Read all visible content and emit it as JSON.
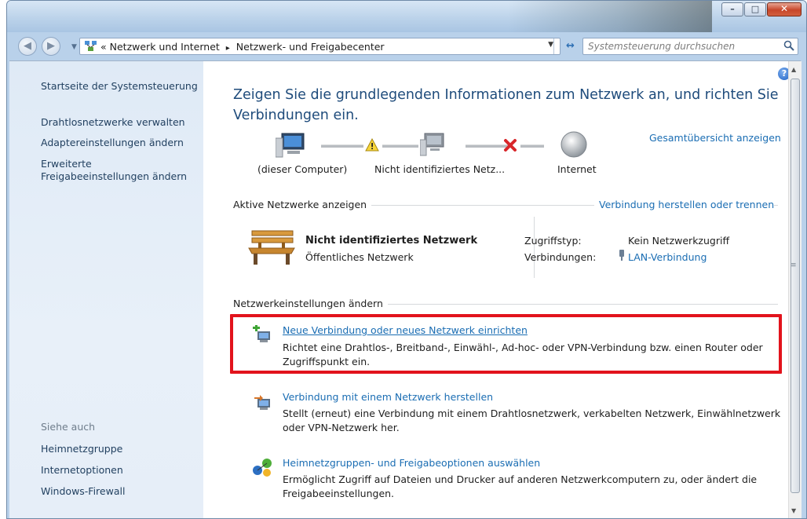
{
  "titlebar": {
    "controls": {
      "minimize": "–",
      "maximize": "□",
      "close": "✕"
    }
  },
  "address": {
    "overflow": "«",
    "path": [
      "Netzwerk und Internet",
      "Netzwerk- und Freigabecenter"
    ],
    "separator": "▸"
  },
  "search": {
    "placeholder": "Systemsteuerung durchsuchen"
  },
  "sidebar": {
    "items": [
      {
        "label": "Startseite der Systemsteuerung"
      },
      {
        "label": "Drahtlosnetzwerke verwalten"
      },
      {
        "label": "Adaptereinstellungen ändern"
      },
      {
        "label": "Erweiterte Freigabeeinstellungen ändern"
      }
    ],
    "see_also_title": "Siehe auch",
    "see_also": [
      {
        "label": "Heimnetzgruppe"
      },
      {
        "label": "Internetoptionen"
      },
      {
        "label": "Windows-Firewall"
      }
    ]
  },
  "main": {
    "heading": "Zeigen Sie die grundlegenden Informationen zum Netzwerk an, und richten Sie Verbindungen ein.",
    "overview_link": "Gesamtübersicht anzeigen",
    "map": {
      "computer": "(dieser Computer)",
      "network": "Nicht identifiziertes Netz...",
      "internet": "Internet"
    },
    "active": {
      "title": "Aktive Netzwerke anzeigen",
      "connect_link": "Verbindung herstellen oder trennen",
      "network_name": "Nicht identifiziertes Netzwerk",
      "network_type": "Öffentliches Netzwerk",
      "access_label": "Zugriffstyp:",
      "access_value": "Kein Netzwerkzugriff",
      "connections_label": "Verbindungen:",
      "connections_value": "LAN-Verbindung"
    },
    "settings": {
      "title": "Netzwerkeinstellungen ändern",
      "tasks": [
        {
          "link": "Neue Verbindung oder neues Netzwerk einrichten",
          "desc": "Richtet eine Drahtlos-, Breitband-, Einwähl-, Ad-hoc- oder VPN-Verbindung bzw. einen Router oder Zugriffspunkt ein."
        },
        {
          "link": "Verbindung mit einem Netzwerk herstellen",
          "desc": "Stellt (erneut) eine Verbindung mit einem Drahtlosnetzwerk, verkabelten Netzwerk, Einwählnetzwerk oder VPN-Netzwerk her."
        },
        {
          "link": "Heimnetzgruppen- und Freigabeoptionen auswählen",
          "desc": "Ermöglicht Zugriff auf Dateien und Drucker auf anderen Netzwerkcomputern zu, oder ändert die Freigabeeinstellungen."
        }
      ]
    }
  },
  "colors": {
    "link": "#1a6db3",
    "heading": "#1e4b7b",
    "highlight": "#e2131c"
  }
}
